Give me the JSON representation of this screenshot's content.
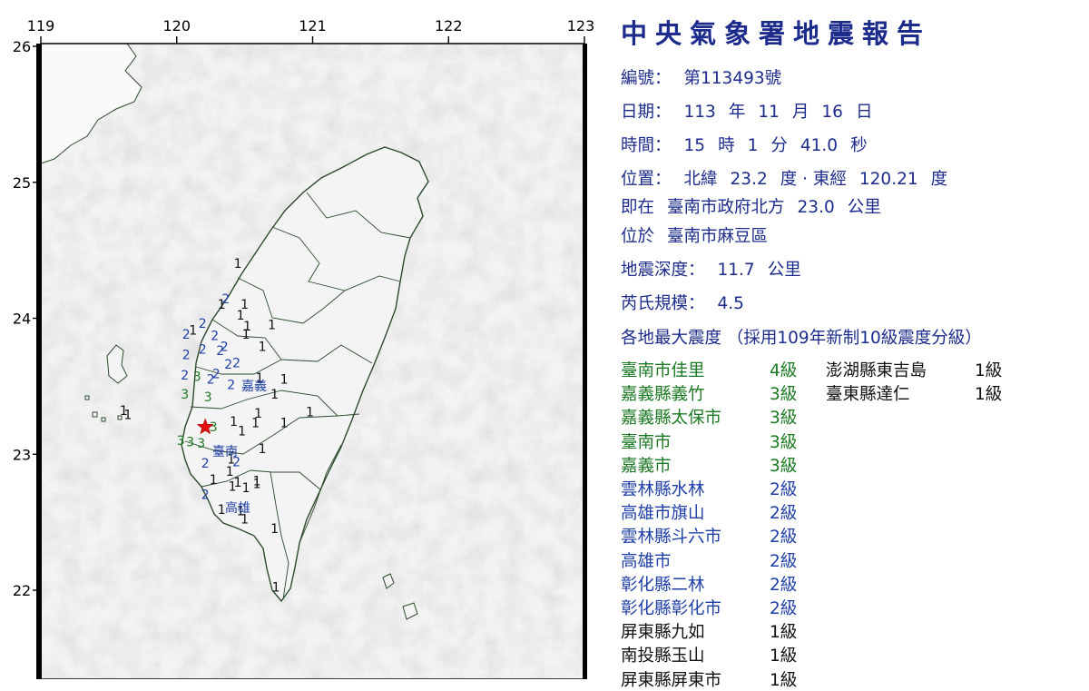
{
  "map": {
    "lon_ticks": [
      "119",
      "120",
      "121",
      "122",
      "123"
    ],
    "lat_ticks": [
      "26",
      "25",
      "24",
      "23",
      "22"
    ],
    "epicenter_lon": 120.21,
    "epicenter_lat": 23.2,
    "city_labels": [
      "嘉義",
      "臺南",
      "高雄"
    ],
    "intensity_marks": [
      {
        "v": "1",
        "lon": 120.45,
        "lat": 24.37
      },
      {
        "v": "2",
        "lon": 120.36,
        "lat": 24.11
      },
      {
        "v": "1",
        "lon": 120.33,
        "lat": 24.07
      },
      {
        "v": "1",
        "lon": 120.5,
        "lat": 24.07
      },
      {
        "v": "1",
        "lon": 120.47,
        "lat": 23.99
      },
      {
        "v": "2",
        "lon": 120.19,
        "lat": 23.93
      },
      {
        "v": "1",
        "lon": 120.12,
        "lat": 23.88
      },
      {
        "v": "2",
        "lon": 120.07,
        "lat": 23.85
      },
      {
        "v": "1",
        "lon": 120.52,
        "lat": 23.91
      },
      {
        "v": "1",
        "lon": 120.7,
        "lat": 23.92
      },
      {
        "v": "2",
        "lon": 120.28,
        "lat": 23.84
      },
      {
        "v": "1",
        "lon": 120.51,
        "lat": 23.85
      },
      {
        "v": "2",
        "lon": 120.35,
        "lat": 23.76
      },
      {
        "v": "2",
        "lon": 120.19,
        "lat": 23.74
      },
      {
        "v": "2",
        "lon": 120.32,
        "lat": 23.73
      },
      {
        "v": "1",
        "lon": 120.63,
        "lat": 23.76
      },
      {
        "v": "2",
        "lon": 120.07,
        "lat": 23.7
      },
      {
        "v": "2",
        "lon": 120.44,
        "lat": 23.64
      },
      {
        "v": "2",
        "lon": 120.38,
        "lat": 23.63
      },
      {
        "v": "2",
        "lon": 120.06,
        "lat": 23.55
      },
      {
        "v": "3",
        "lon": 120.15,
        "lat": 23.54
      },
      {
        "v": "2",
        "lon": 120.29,
        "lat": 23.56
      },
      {
        "v": "2",
        "lon": 120.25,
        "lat": 23.52
      },
      {
        "v": "2",
        "lon": 120.4,
        "lat": 23.48
      },
      {
        "v": "1",
        "lon": 120.61,
        "lat": 23.53
      },
      {
        "v": "1",
        "lon": 120.79,
        "lat": 23.52
      },
      {
        "v": "3",
        "lon": 120.06,
        "lat": 23.41
      },
      {
        "v": "3",
        "lon": 120.23,
        "lat": 23.39
      },
      {
        "v": "1",
        "lon": 120.72,
        "lat": 23.41
      },
      {
        "v": "1",
        "lon": 120.98,
        "lat": 23.28
      },
      {
        "v": "1",
        "lon": 119.61,
        "lat": 23.29
      },
      {
        "v": "1",
        "lon": 119.64,
        "lat": 23.26
      },
      {
        "v": "3",
        "lon": 120.27,
        "lat": 23.17
      },
      {
        "v": "1",
        "lon": 120.6,
        "lat": 23.27
      },
      {
        "v": "1",
        "lon": 120.79,
        "lat": 23.2
      },
      {
        "v": "1",
        "lon": 120.42,
        "lat": 23.21
      },
      {
        "v": "1",
        "lon": 120.58,
        "lat": 23.2
      },
      {
        "v": "1",
        "lon": 120.48,
        "lat": 23.14
      },
      {
        "v": "3",
        "lon": 120.03,
        "lat": 23.07
      },
      {
        "v": "3",
        "lon": 120.18,
        "lat": 23.05
      },
      {
        "v": "3",
        "lon": 120.1,
        "lat": 23.06
      },
      {
        "v": "1",
        "lon": 120.63,
        "lat": 23.01
      },
      {
        "v": "1",
        "lon": 120.4,
        "lat": 22.93
      },
      {
        "v": "2",
        "lon": 120.21,
        "lat": 22.9
      },
      {
        "v": "2",
        "lon": 120.44,
        "lat": 22.91
      },
      {
        "v": "1",
        "lon": 120.39,
        "lat": 22.84
      },
      {
        "v": "1",
        "lon": 120.27,
        "lat": 22.78
      },
      {
        "v": "1",
        "lon": 120.45,
        "lat": 22.76
      },
      {
        "v": "1",
        "lon": 120.59,
        "lat": 22.77
      },
      {
        "v": "1",
        "lon": 120.59,
        "lat": 22.75
      },
      {
        "v": "1",
        "lon": 120.41,
        "lat": 22.73
      },
      {
        "v": "1",
        "lon": 120.51,
        "lat": 22.72
      },
      {
        "v": "2",
        "lon": 120.21,
        "lat": 22.67
      },
      {
        "v": "1",
        "lon": 120.47,
        "lat": 22.55
      },
      {
        "v": "1",
        "lon": 120.33,
        "lat": 22.56
      },
      {
        "v": "1",
        "lon": 120.5,
        "lat": 22.49
      },
      {
        "v": "1",
        "lon": 120.72,
        "lat": 22.42
      },
      {
        "v": "1",
        "lon": 120.73,
        "lat": 21.99
      }
    ]
  },
  "report": {
    "title": "中央氣象署地震報告",
    "number_label": "編號：",
    "number_value": "第113493號",
    "date_label": "日期：",
    "date_parts": [
      "113",
      "年",
      "11",
      "月",
      "16",
      "日"
    ],
    "time_label": "時間：",
    "time_parts": [
      "15",
      "時",
      "1",
      "分",
      "41.0",
      "秒"
    ],
    "position_label": "位置：",
    "position_parts": [
      "北緯",
      "23.2",
      "度 · 東經",
      "120.21",
      "度"
    ],
    "at_label": "即在",
    "at_parts": [
      "臺南市政府北方",
      "23.0",
      "公里"
    ],
    "located_label": "位於",
    "located_value": "臺南市麻豆區",
    "depth_label": "地震深度：",
    "depth_parts": [
      "11.7",
      "公里"
    ],
    "magnitude_label": "芮氏規模：",
    "magnitude_value": "4.5",
    "intensity_heading": "各地最大震度 （採用109年新制10級震度分級）",
    "intensity_left": [
      {
        "place": "臺南市佳里",
        "level": "4級",
        "cls": "c4"
      },
      {
        "place": "嘉義縣義竹",
        "level": "3級",
        "cls": "c3"
      },
      {
        "place": "嘉義縣太保市",
        "level": "3級",
        "cls": "c3"
      },
      {
        "place": "臺南市",
        "level": "3級",
        "cls": "c3"
      },
      {
        "place": "嘉義市",
        "level": "3級",
        "cls": "c3"
      },
      {
        "place": "雲林縣水林",
        "level": "2級",
        "cls": "c2"
      },
      {
        "place": "高雄市旗山",
        "level": "2級",
        "cls": "c2"
      },
      {
        "place": "雲林縣斗六市",
        "level": "2級",
        "cls": "c2"
      },
      {
        "place": "高雄市",
        "level": "2級",
        "cls": "c2"
      },
      {
        "place": "彰化縣二林",
        "level": "2級",
        "cls": "c2"
      },
      {
        "place": "彰化縣彰化市",
        "level": "2級",
        "cls": "c2"
      },
      {
        "place": "屏東縣九如",
        "level": "1級",
        "cls": "c1"
      },
      {
        "place": "南投縣玉山",
        "level": "1級",
        "cls": "c1"
      },
      {
        "place": "屏東縣屏東市",
        "level": "1級",
        "cls": "c1"
      }
    ],
    "intensity_right": [
      {
        "place": "澎湖縣東吉島",
        "level": "1級",
        "cls": "c1"
      },
      {
        "place": "臺東縣達仁",
        "level": "1級",
        "cls": "c1"
      }
    ]
  },
  "colors": {
    "title": "#1d2c8c",
    "level4": "#1d7a24",
    "level3": "#1d7a24",
    "level2": "#1f3fa6",
    "level1": "#111111",
    "epicenter": "#e01010"
  }
}
